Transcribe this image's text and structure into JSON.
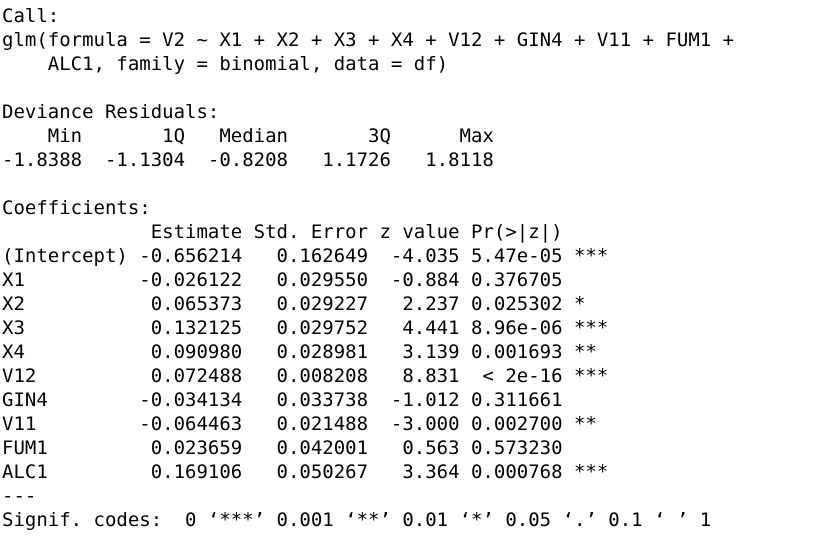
{
  "call": {
    "header": "Call:",
    "line1": "glm(formula = V2 ~ X1 + X2 + X3 + X4 + V12 + GIN4 + V11 + FUM1 +",
    "line2": "    ALC1, family = binomial, data = df)"
  },
  "deviance_residuals": {
    "header": "Deviance Residuals:",
    "labels_line": "    Min       1Q   Median       3Q      Max  ",
    "values_line": "-1.8388  -1.1304  -0.8208   1.1726   1.8118  "
  },
  "coefficients": {
    "header": "Coefficients:",
    "column_header": "             Estimate Std. Error z value Pr(>|z|)    ",
    "rows": [
      "(Intercept) -0.656214   0.162649  -4.035 5.47e-05 ***",
      "X1          -0.026122   0.029550  -0.884 0.376705    ",
      "X2           0.065373   0.029227   2.237 0.025302 *  ",
      "X3           0.132125   0.029752   4.441 8.96e-06 ***",
      "X4           0.090980   0.028981   3.139 0.001693 ** ",
      "V12          0.072488   0.008208   8.831  < 2e-16 ***",
      "GIN4        -0.034134   0.033738  -1.012 0.311661    ",
      "V11         -0.064463   0.021488  -3.000 0.002700 ** ",
      "FUM1         0.023659   0.042001   0.563 0.573230    ",
      "ALC1         0.169106   0.050267   3.364 0.000768 ***"
    ],
    "separator": "---",
    "signif_codes": "Signif. codes:  0 ‘***’ 0.001 ‘**’ 0.01 ‘*’ 0.05 ‘.’ 0.1 ‘ ’ 1"
  }
}
